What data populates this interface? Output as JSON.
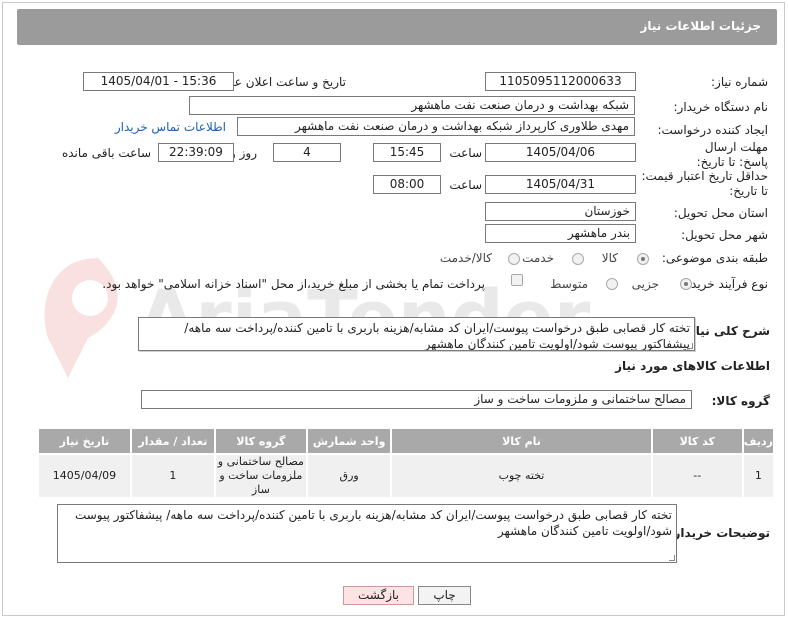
{
  "header": {
    "title": "جزئیات اطلاعات نیاز"
  },
  "fields": {
    "need_number": {
      "label": "شماره نیاز:",
      "value": "1105095112000633"
    },
    "announce_datetime": {
      "label": "تاریخ و ساعت اعلان عمومی:",
      "value": "1405/04/01 - 15:36"
    },
    "buyer_org": {
      "label": "نام دستگاه خریدار:",
      "value": "شبکه بهداشت و درمان صنعت نفت ماهشهر"
    },
    "requester": {
      "label": "ایجاد کننده درخواست:",
      "value": "مهدی طلاوری کارپرداز شبکه بهداشت و درمان صنعت نفت ماهشهر",
      "contact_link": "اطلاعات تماس خریدار"
    },
    "reply_deadline": {
      "label": "مهلت ارسال پاسخ: تا تاریخ:",
      "date": "1405/04/06",
      "time_label": "ساعت",
      "time": "15:45",
      "days": "4",
      "days_label": "روز و",
      "remaining": "22:39:09",
      "remaining_label": "ساعت باقی مانده"
    },
    "price_validity": {
      "label": "حداقل تاریخ اعتبار قیمت: تا تاریخ:",
      "date": "1405/04/31",
      "time_label": "ساعت",
      "time": "08:00"
    },
    "delivery_province": {
      "label": "استان محل تحویل:",
      "value": "خوزستان"
    },
    "delivery_city": {
      "label": "شهر محل تحویل:",
      "value": "بندر ماهشهر"
    },
    "category": {
      "label": "طبقه بندی موضوعی:",
      "options": [
        "کالا",
        "خدمت",
        "کالا/خدمت"
      ],
      "selected": "کالا"
    },
    "purchase_process": {
      "label": "نوع فرآیند خرید :",
      "options": [
        "جزیی",
        "متوسط"
      ],
      "selected": "جزیی",
      "treasury_note": "پرداخت تمام یا بخشی از مبلغ خرید،از محل \"اسناد خزانه اسلامی\" خواهد بود."
    }
  },
  "description": {
    "label": "شرح کلی نیاز:",
    "value": "تخته کار قصابی طبق درخواست پیوست/ایران کد مشابه/هزینه باربری با تامین کننده/پرداخت سه ماهه/ پیشفاکتور پیوست شود/اولویت تامین کنندگان ماهشهر"
  },
  "goods_info": {
    "section_title": "اطلاعات کالاهای مورد نیاز",
    "group_label": "گروه کالا:",
    "group_value": "مصالح ساختمانی و ملزومات ساخت و ساز",
    "columns": [
      "ردیف",
      "کد کالا",
      "نام کالا",
      "واحد شمارش",
      "گروه کالا",
      "تعداد / مقدار",
      "تاریخ نیاز"
    ],
    "rows": [
      {
        "row": "1",
        "code": "--",
        "name": "تخته چوب",
        "unit": "ورق",
        "group": "مصالح ساختمانی و ملزومات ساخت و ساز",
        "qty": "1",
        "date": "1405/04/09"
      }
    ]
  },
  "buyer_notes": {
    "label": "توضیحات خریدار:",
    "value": "تخته کار قصابی طبق درخواست پیوست/ایران کد مشابه/هزینه باربری با تامین کننده/پرداخت سه ماهه/ پیشفاکتور پیوست شود/اولویت تامین کنندگان ماهشهر"
  },
  "buttons": {
    "print": "چاپ",
    "back": "بازگشت"
  },
  "watermark": "AriaTender.neT",
  "colors": {
    "titlebar": "#9b9b9b",
    "table_header": "#a9a9a9",
    "link": "#1a5fb4",
    "back_button": "#fde3e3"
  }
}
